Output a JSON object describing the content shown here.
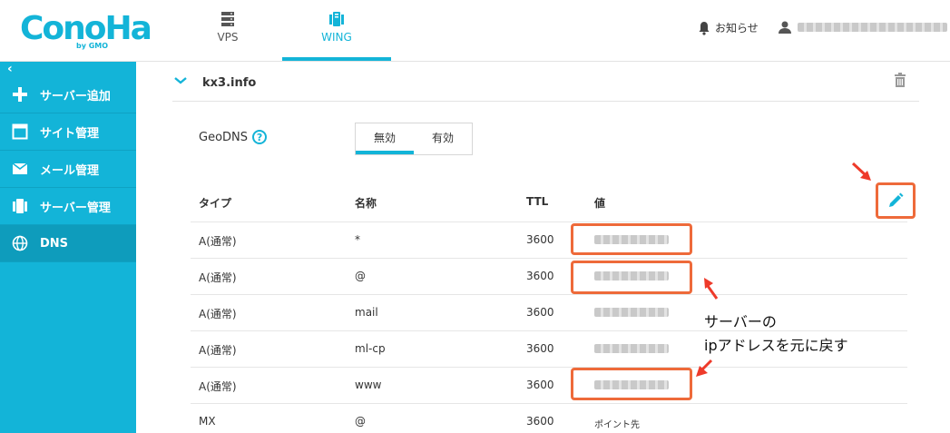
{
  "brand": {
    "logo": "ConoHa",
    "logo_sub": "by GMO",
    "accent": "#13b4d8",
    "highlight": "#ee6a3a"
  },
  "top_tabs": [
    {
      "label": "VPS",
      "icon": "server-stack-icon"
    },
    {
      "label": "WING",
      "icon": "wing-server-icon",
      "active": true
    }
  ],
  "header": {
    "notice_label": "お知らせ",
    "notice_icon": "bell-icon",
    "user_icon": "user-icon"
  },
  "sidebar": {
    "collapse_icon": "chevron-left-icon",
    "items": [
      {
        "label": "サーバー追加",
        "icon": "plus-icon"
      },
      {
        "label": "サイト管理",
        "icon": "window-icon"
      },
      {
        "label": "メール管理",
        "icon": "mail-icon"
      },
      {
        "label": "サーバー管理",
        "icon": "server-icon"
      },
      {
        "label": "DNS",
        "icon": "globe-icon",
        "active": true
      }
    ]
  },
  "domain": {
    "name": "kx3.info",
    "expand_icon": "chevron-down-icon",
    "delete_icon": "trash-icon"
  },
  "geodns": {
    "label": "GeoDNS",
    "help_icon": "help-icon",
    "options": [
      "無効",
      "有効"
    ],
    "selected": "無効"
  },
  "records": {
    "headers": {
      "type": "タイプ",
      "name": "名称",
      "ttl": "TTL",
      "value": "値"
    },
    "edit_icon": "pencil-icon",
    "rows": [
      {
        "type": "A(通常)",
        "name": "*",
        "ttl": "3600",
        "value": ""
      },
      {
        "type": "A(通常)",
        "name": "@",
        "ttl": "3600",
        "value": ""
      },
      {
        "type": "A(通常)",
        "name": "mail",
        "ttl": "3600",
        "value": ""
      },
      {
        "type": "A(通常)",
        "name": "ml-cp",
        "ttl": "3600",
        "value": ""
      },
      {
        "type": "A(通常)",
        "name": "www",
        "ttl": "3600",
        "value": ""
      },
      {
        "type": "MX",
        "name": "@",
        "ttl": "3600",
        "value": "ポイント先"
      }
    ]
  },
  "annotation": {
    "line1": "サーバーの",
    "line2": "ipアドレスを元に戻す"
  }
}
